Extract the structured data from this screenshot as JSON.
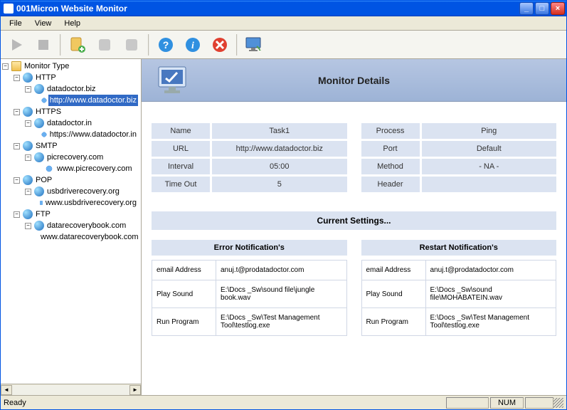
{
  "window": {
    "title": "001Micron Website Monitor"
  },
  "menu": {
    "file": "File",
    "view": "View",
    "help": "Help"
  },
  "tree": {
    "root": "Monitor Type",
    "http": "HTTP",
    "http_site": "datadoctor.biz",
    "http_url": "http://www.datadoctor.biz",
    "https": "HTTPS",
    "https_site": "datadoctor.in",
    "https_url": "https://www.datadoctor.in",
    "smtp": "SMTP",
    "smtp_site": "picrecovery.com",
    "smtp_url": "www.picrecovery.com",
    "pop": "POP",
    "pop_site": "usbdriverecovery.org",
    "pop_url": "www.usbdriverecovery.org",
    "ftp": "FTP",
    "ftp_site": "datarecoverybook.com",
    "ftp_url": "www.datarecoverybook.com"
  },
  "details": {
    "title": "Monitor Details",
    "left": {
      "name_label": "Name",
      "name_value": "Task1",
      "url_label": "URL",
      "url_value": "http://www.datadoctor.biz",
      "interval_label": "Interval",
      "interval_value": "05:00",
      "timeout_label": "Time Out",
      "timeout_value": "5"
    },
    "right": {
      "process_label": "Process",
      "process_value": "Ping",
      "port_label": "Port",
      "port_value": "Default",
      "method_label": "Method",
      "method_value": "- NA -",
      "header_label": "Header",
      "header_value": ""
    },
    "current_settings": "Current Settings...",
    "error_header": "Error Notification's",
    "restart_header": "Restart Notification's",
    "email_label": "email Address",
    "play_label": "Play Sound",
    "run_label": "Run Program",
    "error": {
      "email": "anuj.t@prodatadoctor.com",
      "sound": "E:\\Docs _Sw\\sound file\\jungle book.wav",
      "program": "E:\\Docs _Sw\\Test Management Tool\\testlog.exe"
    },
    "restart": {
      "email": "anuj.t@prodatadoctor.com",
      "sound": "E:\\Docs _Sw\\sound file\\MOHABATEIN.wav",
      "program": "E:\\Docs _Sw\\Test Management Tool\\testlog.exe"
    }
  },
  "status": {
    "ready": "Ready",
    "num": "NUM"
  }
}
